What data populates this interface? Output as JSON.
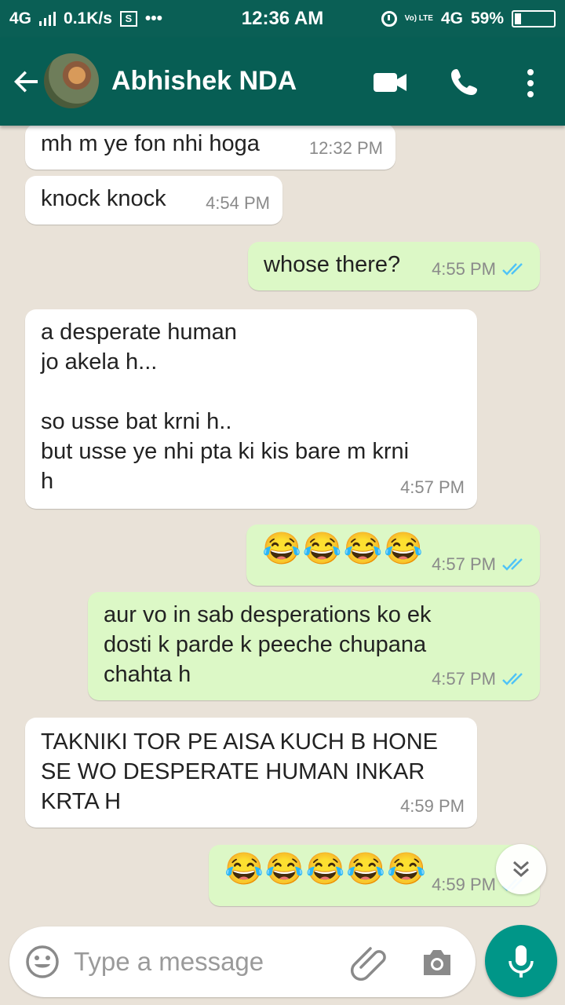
{
  "status_bar": {
    "network": "4G",
    "speed": "0.1K/s",
    "sim_badge": "S",
    "dots": "•••",
    "time": "12:36 AM",
    "volte": "Vo) LTE",
    "network_right": "4G",
    "battery": "59%"
  },
  "header": {
    "contact_name": "Abhishek NDA",
    "icons": [
      "back-arrow-icon",
      "avatar",
      "video-call-icon",
      "voice-call-icon",
      "more-options-icon"
    ]
  },
  "messages": [
    {
      "direction": "in",
      "text": "mh m ye fon nhi hoga",
      "time": "12:32 PM"
    },
    {
      "direction": "in",
      "text": "knock knock",
      "time": "4:54 PM"
    },
    {
      "direction": "out",
      "text": "whose there?",
      "time": "4:55 PM",
      "status": "read"
    },
    {
      "direction": "in",
      "text": "a desperate human\njo akela h...\n\nso usse bat krni h..\nbut usse ye nhi pta ki kis bare m krni\nh",
      "time": "4:57 PM"
    },
    {
      "direction": "out",
      "text": "😂😂😂😂",
      "time": "4:57 PM",
      "status": "read"
    },
    {
      "direction": "out",
      "text": "aur vo in sab desperations ko ek\ndosti k parde k peeche chupana\nchahta h",
      "time": "4:57 PM",
      "status": "read"
    },
    {
      "direction": "in",
      "text": "TAKNIKI TOR PE AISA KUCH B HONE\nSE WO DESPERATE HUMAN INKAR\nKRTA H",
      "time": "4:59 PM"
    },
    {
      "direction": "out",
      "text": "😂😂😂😂😂",
      "time": "4:59 PM",
      "status": "read"
    }
  ],
  "composer": {
    "placeholder": "Type a message"
  },
  "colors": {
    "header": "#075e54",
    "status_bar": "#0a5f55",
    "outgoing_bubble": "#dcf8c6",
    "incoming_bubble": "#ffffff",
    "read_tick": "#4fc3f7",
    "mic_button": "#009688"
  }
}
